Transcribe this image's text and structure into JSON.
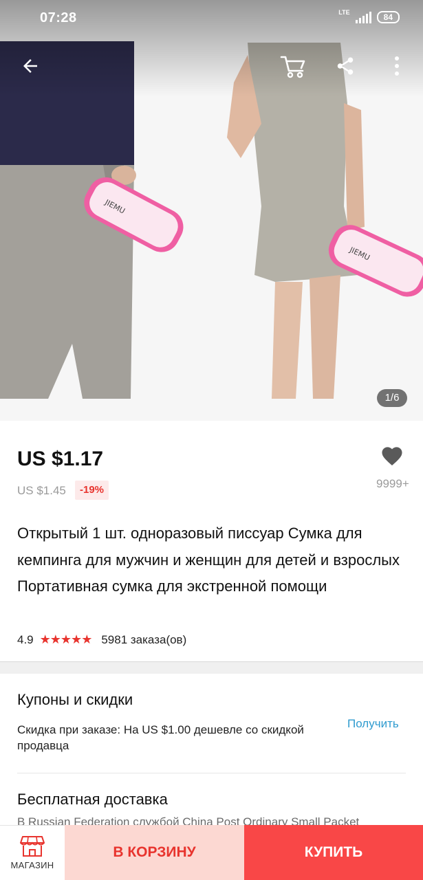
{
  "status_bar": {
    "time": "07:28",
    "network": "LTE",
    "battery": "84"
  },
  "toolbar": {
    "back_icon": "arrow-back-icon",
    "cart_icon": "cart-icon",
    "share_icon": "share-icon",
    "more_icon": "more-vertical-icon"
  },
  "gallery": {
    "counter": "1/6"
  },
  "product": {
    "price": "US $1.17",
    "old_price": "US $1.45",
    "discount": "-19%",
    "wishlist_count": "9999+",
    "title": "Открытый 1 шт. одноразовый писсуар Сумка для кемпинга для мужчин и женщин для детей и взрослых Портативная сумка для экстренной помощи",
    "rating": "4.9",
    "stars": "★★★★★",
    "orders": "5981 заказа(ов)"
  },
  "coupons": {
    "title": "Купоны и скидки",
    "text": "Скидка при заказе: На US $1.00 дешевле со скидкой продавца",
    "action": "Получить"
  },
  "shipping": {
    "title": "Бесплатная доставка",
    "text": "В Russian Federation службой China Post Ordinary Small Packet"
  },
  "bottom_bar": {
    "store_label": "МАГАЗИН",
    "add_to_cart": "В КОРЗИНУ",
    "buy_now": "КУПИТЬ"
  },
  "colors": {
    "accent": "#e8342e",
    "buy": "#f94747",
    "cart_bg": "#fcd8d2",
    "link": "#2f9bcf"
  }
}
